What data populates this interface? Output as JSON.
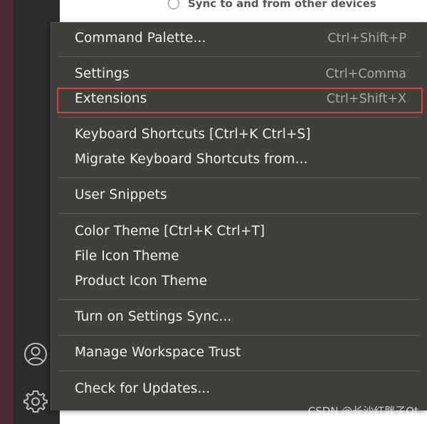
{
  "background": {
    "sync_option_label": "Sync to and from other devices"
  },
  "activity_bar": {
    "icons": [
      "account-icon",
      "gear-icon"
    ]
  },
  "menu": {
    "items": [
      {
        "label": "Command Palette...",
        "shortcut": "Ctrl+Shift+P"
      },
      {
        "label": "Settings",
        "shortcut": "Ctrl+Comma"
      },
      {
        "label": "Extensions",
        "shortcut": "Ctrl+Shift+X"
      },
      {
        "label": "Keyboard Shortcuts [Ctrl+K Ctrl+S]",
        "shortcut": ""
      },
      {
        "label": "Migrate Keyboard Shortcuts from...",
        "shortcut": ""
      },
      {
        "label": "User Snippets",
        "shortcut": ""
      },
      {
        "label": "Color Theme [Ctrl+K Ctrl+T]",
        "shortcut": ""
      },
      {
        "label": "File Icon Theme",
        "shortcut": ""
      },
      {
        "label": "Product Icon Theme",
        "shortcut": ""
      },
      {
        "label": "Turn on Settings Sync...",
        "shortcut": ""
      },
      {
        "label": "Manage Workspace Trust",
        "shortcut": ""
      },
      {
        "label": "Check for Updates...",
        "shortcut": ""
      }
    ]
  },
  "watermark": "CSDN @长沙红胖子Qt",
  "colors": {
    "menu_background": "#3f3f3c",
    "highlight_border": "#e03a3a",
    "activity_bar": "#2c2c2c"
  }
}
